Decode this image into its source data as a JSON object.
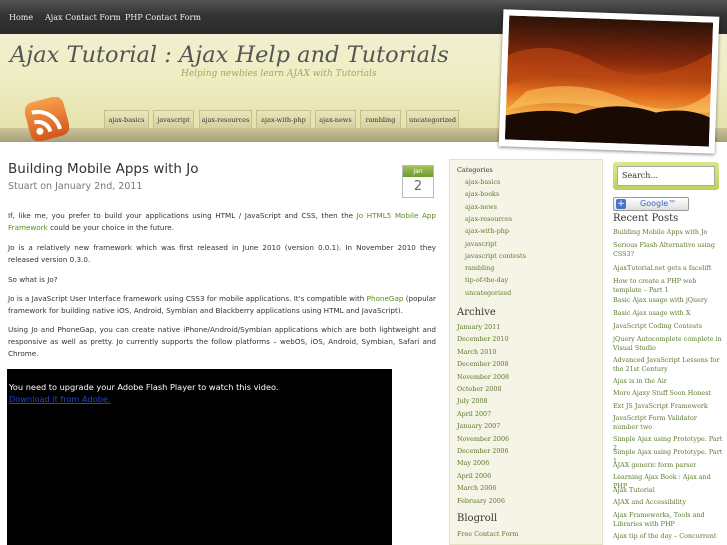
{
  "nav": [
    "Home",
    "Ajax Contact Form",
    "PHP Contact Form"
  ],
  "site": {
    "title": "Ajax Tutorial : Ajax Help and Tutorials",
    "tagline": "Helping newbies learn AJAX with Tutorials"
  },
  "category_tabs": [
    "ajax-basics",
    "javascript",
    "ajax-resources",
    "ajax-with-php",
    "ajax-news",
    "rambling",
    "uncategorized"
  ],
  "post": {
    "title": "Building Mobile Apps with Jo",
    "meta": "Stuart on January 2nd, 2011",
    "cal_month": "Jan",
    "cal_day": "2",
    "p1_before": "If, like me, you prefer to build your applications using HTML / JavaScript and CSS, then the ",
    "p1_link": "Jo HTML5 Mobile App Framework",
    "p1_after": " could be your choice in the future.",
    "p2": "Jo is a relatively new framework which was first released in June 2010 (version 0.0.1). In November 2010 they released version 0.3.0.",
    "p3": "So what is Jo?",
    "p4_before": "Jo is a JavaScript User Interface framework using CSS3 for mobile applications. It's compatible with ",
    "p4_link": "PhoneGap",
    "p4_after": " (popular framework for building native iOS, Android, Symbian and Blackberry applications using HTML and JavaScript).",
    "p5": "Using Jo and PhoneGap, you can create native iPhone/Android/Symbian applications which are both lightweight and responsive as well as pretty. Jo currently supports the follow platforms – webOS, iOS, Android, Symbian, Safari and Chrome.",
    "flash_msg": "You need to upgrade your Adobe Flash Player to watch this video.",
    "flash_link": "Download it from Adobe."
  },
  "sidebar": {
    "categories_title": "Categories",
    "categories": [
      "ajax-basics",
      "ajax-books",
      "ajax-news",
      "ajax-resources",
      "ajax-with-php",
      "javascript",
      "javascript contests",
      "rambling",
      "tip-of-the-day",
      "uncategorized"
    ],
    "archive_title": "Archive",
    "archive": [
      "January 2011",
      "December 2010",
      "March 2010",
      "December 2008",
      "November 2008",
      "October 2008",
      "July 2008",
      "April 2007",
      "January 2007",
      "November 2006",
      "December 2006",
      "May 2006",
      "April 2006",
      "March 2006",
      "February 2006"
    ],
    "blogroll_title": "Blogroll",
    "blogroll": [
      "Free Contact Form"
    ]
  },
  "right": {
    "search_value": "Search...",
    "google_label": "Google™",
    "recent_title": "Recent Posts",
    "recent": [
      "Building Mobile Apps with Jo",
      "Serious Flash Alternative using CSS3?",
      "AjaxTutorial.net gets a facelift",
      "How to create a PHP web template – Part 1",
      "Basic Ajax usage with jQuery",
      "Basic Ajax usage with X",
      "JavaScript Coding Contests",
      "jQuery Autocomplete complete in Visual Studio",
      "Advanced JavaScript Lessons for the 21st Century",
      "Ajax is in the Air",
      "More Ajaxy Stuff Soon Honest",
      "Ext JS JavaScript Framework",
      "JavaScript Form Validator number two",
      "Simple Ajax using Prototype. Part 2",
      "Simple Ajax using Prototype. Part 1",
      "AJAX generic form parser",
      "Learning Ajax Book : Ajax and PHP",
      "Ajax Tutorial",
      "AJAX and Accessibility",
      "Ajax Frameworks, Tools and Libraries with PHP",
      "Ajax tip of the day – Concurrent"
    ]
  }
}
